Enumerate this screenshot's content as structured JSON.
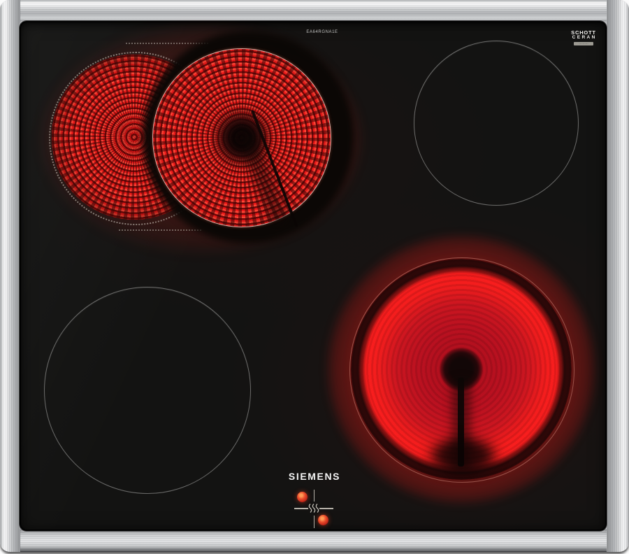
{
  "image_type": "product-photo",
  "subject": "Siemens four-zone glass-ceramic radiant cooktop with stainless steel frame; top-left dual zone and bottom-right zone glowing red",
  "branding": {
    "logo": "SIEMENS",
    "model": "EA64RGNA1E",
    "glass_brand_line1": "SCHOTT",
    "glass_brand_line2": "CERAN",
    "glass_brand_fineprint": "··········"
  },
  "zones": {
    "top_left": {
      "name": "dual extension zone",
      "state": "on"
    },
    "top_right": {
      "name": "standard zone",
      "state": "off"
    },
    "bottom_left": {
      "name": "standard zone",
      "state": "off"
    },
    "bottom_right": {
      "name": "standard zone",
      "state": "on"
    }
  },
  "residual_heat_indicator": {
    "icon": "heat-waves",
    "hot_quadrants": [
      "top-left",
      "bottom-right"
    ]
  },
  "colors": {
    "glass": "#131312",
    "frame_metal": "#c6c8ca",
    "element_red": "#e61717",
    "glow_red": "#ff2a1e",
    "ring_outline": "#d8d4cc",
    "indicator_dot": "#ea4c2b"
  }
}
